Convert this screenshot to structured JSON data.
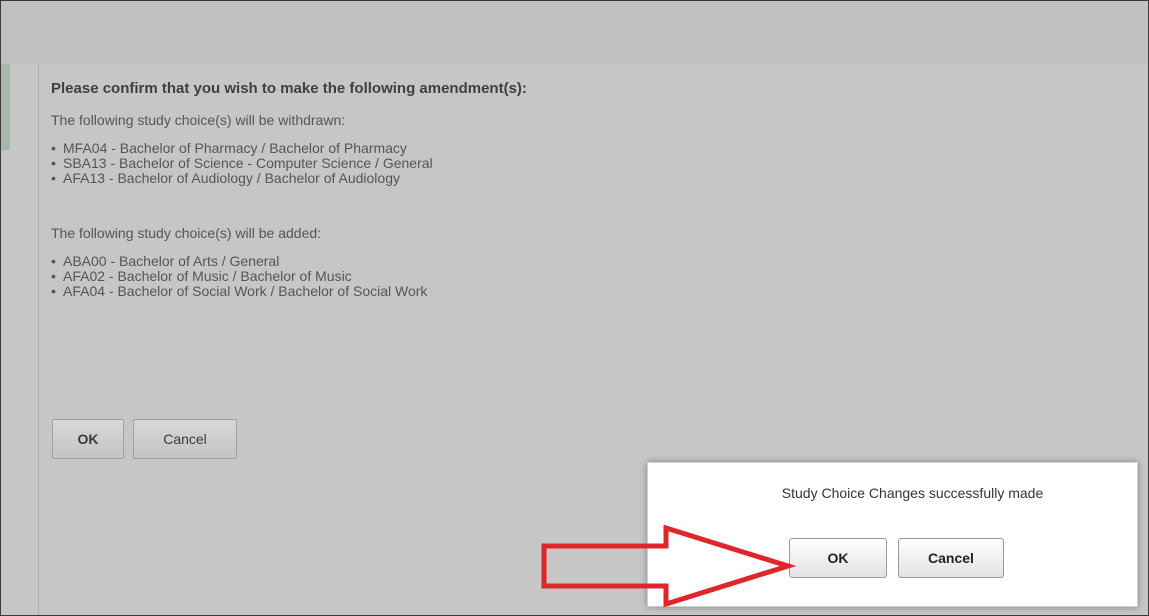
{
  "amendment": {
    "heading": "Please confirm that you wish to make the following amendment(s):",
    "withdrawn_intro": "The following study choice(s) will be withdrawn:",
    "withdrawn": [
      "MFA04 - Bachelor of Pharmacy / Bachelor of Pharmacy",
      "SBA13 - Bachelor of Science - Computer Science / General",
      "AFA13 - Bachelor of Audiology / Bachelor of Audiology"
    ],
    "added_intro": "The following study choice(s) will be added:",
    "added": [
      "ABA00 - Bachelor of Arts / General",
      "AFA02 - Bachelor of Music / Bachelor of Music",
      "AFA04 - Bachelor of Social Work / Bachelor of Social Work"
    ],
    "ok_label": "OK",
    "cancel_label": "Cancel"
  },
  "dialog": {
    "message": "Study Choice Changes successfully made",
    "ok_label": "OK",
    "cancel_label": "Cancel"
  },
  "colors": {
    "overlay_gray": "#c6c6c6",
    "annotation_arrow": "#e0262b",
    "left_accent": "#a9b6ab"
  },
  "bullet_glyph": "•"
}
